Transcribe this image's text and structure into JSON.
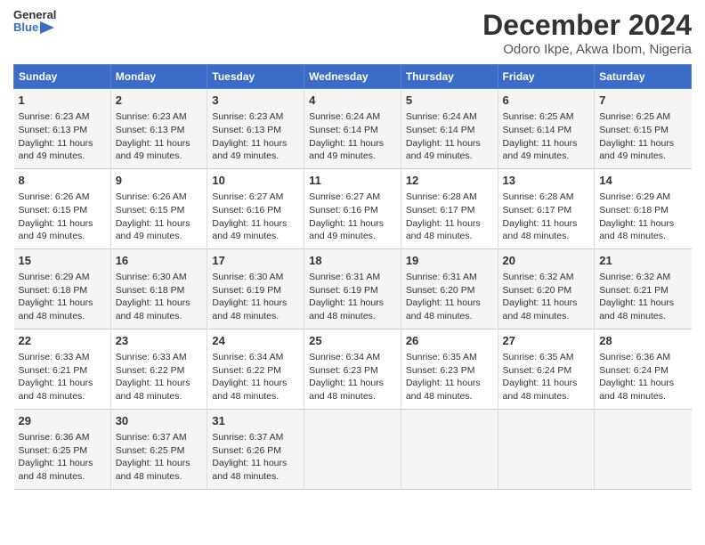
{
  "header": {
    "logo_line1": "General",
    "logo_line2": "Blue",
    "title": "December 2024",
    "subtitle": "Odoro Ikpe, Akwa Ibom, Nigeria"
  },
  "columns": [
    "Sunday",
    "Monday",
    "Tuesday",
    "Wednesday",
    "Thursday",
    "Friday",
    "Saturday"
  ],
  "weeks": [
    [
      {
        "day": "1",
        "sunrise": "6:23 AM",
        "sunset": "6:13 PM",
        "daylight": "11 hours and 49 minutes."
      },
      {
        "day": "2",
        "sunrise": "6:23 AM",
        "sunset": "6:13 PM",
        "daylight": "11 hours and 49 minutes."
      },
      {
        "day": "3",
        "sunrise": "6:23 AM",
        "sunset": "6:13 PM",
        "daylight": "11 hours and 49 minutes."
      },
      {
        "day": "4",
        "sunrise": "6:24 AM",
        "sunset": "6:14 PM",
        "daylight": "11 hours and 49 minutes."
      },
      {
        "day": "5",
        "sunrise": "6:24 AM",
        "sunset": "6:14 PM",
        "daylight": "11 hours and 49 minutes."
      },
      {
        "day": "6",
        "sunrise": "6:25 AM",
        "sunset": "6:14 PM",
        "daylight": "11 hours and 49 minutes."
      },
      {
        "day": "7",
        "sunrise": "6:25 AM",
        "sunset": "6:15 PM",
        "daylight": "11 hours and 49 minutes."
      }
    ],
    [
      {
        "day": "8",
        "sunrise": "6:26 AM",
        "sunset": "6:15 PM",
        "daylight": "11 hours and 49 minutes."
      },
      {
        "day": "9",
        "sunrise": "6:26 AM",
        "sunset": "6:15 PM",
        "daylight": "11 hours and 49 minutes."
      },
      {
        "day": "10",
        "sunrise": "6:27 AM",
        "sunset": "6:16 PM",
        "daylight": "11 hours and 49 minutes."
      },
      {
        "day": "11",
        "sunrise": "6:27 AM",
        "sunset": "6:16 PM",
        "daylight": "11 hours and 49 minutes."
      },
      {
        "day": "12",
        "sunrise": "6:28 AM",
        "sunset": "6:17 PM",
        "daylight": "11 hours and 48 minutes."
      },
      {
        "day": "13",
        "sunrise": "6:28 AM",
        "sunset": "6:17 PM",
        "daylight": "11 hours and 48 minutes."
      },
      {
        "day": "14",
        "sunrise": "6:29 AM",
        "sunset": "6:18 PM",
        "daylight": "11 hours and 48 minutes."
      }
    ],
    [
      {
        "day": "15",
        "sunrise": "6:29 AM",
        "sunset": "6:18 PM",
        "daylight": "11 hours and 48 minutes."
      },
      {
        "day": "16",
        "sunrise": "6:30 AM",
        "sunset": "6:18 PM",
        "daylight": "11 hours and 48 minutes."
      },
      {
        "day": "17",
        "sunrise": "6:30 AM",
        "sunset": "6:19 PM",
        "daylight": "11 hours and 48 minutes."
      },
      {
        "day": "18",
        "sunrise": "6:31 AM",
        "sunset": "6:19 PM",
        "daylight": "11 hours and 48 minutes."
      },
      {
        "day": "19",
        "sunrise": "6:31 AM",
        "sunset": "6:20 PM",
        "daylight": "11 hours and 48 minutes."
      },
      {
        "day": "20",
        "sunrise": "6:32 AM",
        "sunset": "6:20 PM",
        "daylight": "11 hours and 48 minutes."
      },
      {
        "day": "21",
        "sunrise": "6:32 AM",
        "sunset": "6:21 PM",
        "daylight": "11 hours and 48 minutes."
      }
    ],
    [
      {
        "day": "22",
        "sunrise": "6:33 AM",
        "sunset": "6:21 PM",
        "daylight": "11 hours and 48 minutes."
      },
      {
        "day": "23",
        "sunrise": "6:33 AM",
        "sunset": "6:22 PM",
        "daylight": "11 hours and 48 minutes."
      },
      {
        "day": "24",
        "sunrise": "6:34 AM",
        "sunset": "6:22 PM",
        "daylight": "11 hours and 48 minutes."
      },
      {
        "day": "25",
        "sunrise": "6:34 AM",
        "sunset": "6:23 PM",
        "daylight": "11 hours and 48 minutes."
      },
      {
        "day": "26",
        "sunrise": "6:35 AM",
        "sunset": "6:23 PM",
        "daylight": "11 hours and 48 minutes."
      },
      {
        "day": "27",
        "sunrise": "6:35 AM",
        "sunset": "6:24 PM",
        "daylight": "11 hours and 48 minutes."
      },
      {
        "day": "28",
        "sunrise": "6:36 AM",
        "sunset": "6:24 PM",
        "daylight": "11 hours and 48 minutes."
      }
    ],
    [
      {
        "day": "29",
        "sunrise": "6:36 AM",
        "sunset": "6:25 PM",
        "daylight": "11 hours and 48 minutes."
      },
      {
        "day": "30",
        "sunrise": "6:37 AM",
        "sunset": "6:25 PM",
        "daylight": "11 hours and 48 minutes."
      },
      {
        "day": "31",
        "sunrise": "6:37 AM",
        "sunset": "6:26 PM",
        "daylight": "11 hours and 48 minutes."
      },
      null,
      null,
      null,
      null
    ]
  ]
}
